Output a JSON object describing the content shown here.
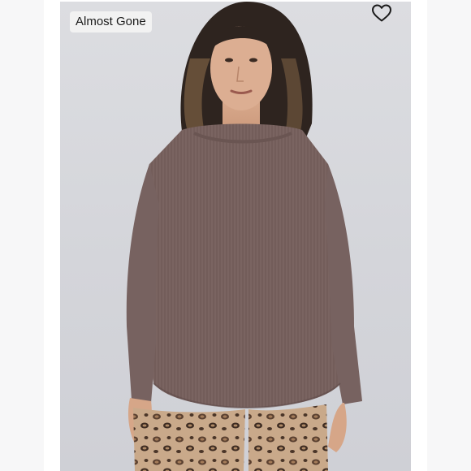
{
  "listing": {
    "badge_label": "Almost Gone",
    "like_icon": "heart-outline-icon"
  },
  "colors": {
    "sweater": "#7a6461",
    "background": "#d8d9de",
    "badge_bg": "#f2f2f2",
    "leopard_base": "#c9a98a"
  }
}
